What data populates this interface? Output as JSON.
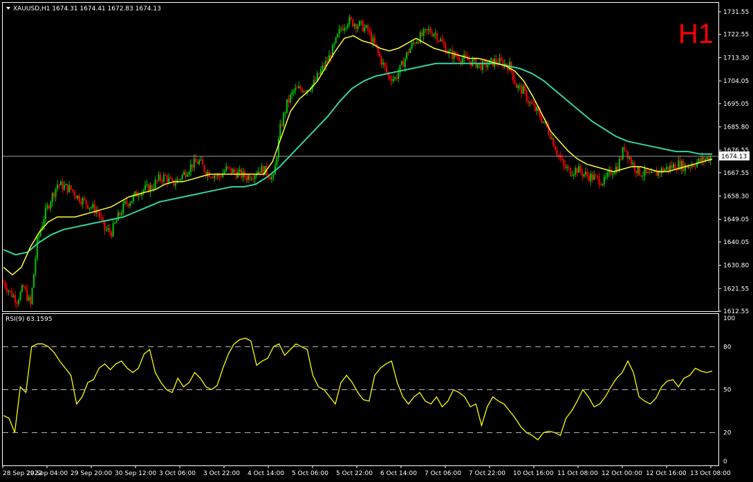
{
  "header": {
    "symbol_line": "XAUUSD,H1  1674.31 1674.41 1672.83 1674.13",
    "timeframe_badge": "H1"
  },
  "price_panel": {
    "current_price_label": "1674.13",
    "y_ticks": [
      "1731.55",
      "1722.55",
      "1713.30",
      "1704.05",
      "1695.05",
      "1685.80",
      "1676.55",
      "1667.55",
      "1658.30",
      "1649.05",
      "1640.05",
      "1630.80",
      "1621.55",
      "1612.55"
    ]
  },
  "rsi_panel": {
    "title": "RSI(9) 63.1595",
    "y_ticks": [
      "100",
      "80",
      "50",
      "20",
      "0"
    ],
    "levels": [
      80,
      50,
      20
    ]
  },
  "x_axis": {
    "labels": [
      "28 Sep 2022",
      "29 Sep 04:00",
      "29 Sep 20:00",
      "30 Sep 12:00",
      "3 Oct 06:00",
      "3 Oct 22:00",
      "4 Oct 14:00",
      "5 Oct 06:00",
      "5 Oct 22:00",
      "6 Oct 14:00",
      "7 Oct 06:00",
      "7 Oct 22:00",
      "10 Oct 16:00",
      "11 Oct 08:00",
      "12 Oct 00:00",
      "12 Oct 16:00",
      "13 Oct 08:00"
    ]
  },
  "colors": {
    "background": "#000000",
    "bull_candle": "#00c800",
    "bear_candle": "#ff0000",
    "ma_fast": "#ffff33",
    "ma_slow": "#33d6a0",
    "rsi_line": "#ffff00",
    "axis": "#ffffff",
    "timeframe": "#ff0000"
  },
  "chart_data": {
    "type": "candlestick",
    "symbol": "XAUUSD",
    "timeframe": "H1",
    "last_bar": {
      "open": 1674.31,
      "high": 1674.41,
      "low": 1672.83,
      "close": 1674.13
    },
    "y_range": [
      1612.55,
      1731.55
    ],
    "price_path_close": [
      1624,
      1620,
      1617,
      1622,
      1615,
      1640,
      1650,
      1657,
      1663,
      1662,
      1661,
      1658,
      1656,
      1654,
      1652,
      1645,
      1644,
      1650,
      1655,
      1657,
      1660,
      1661,
      1662,
      1665,
      1666,
      1663,
      1665,
      1668,
      1671,
      1672,
      1668,
      1667,
      1666,
      1669,
      1668,
      1667,
      1666,
      1667,
      1669,
      1668,
      1665,
      1685,
      1695,
      1700,
      1701,
      1701,
      1703,
      1708,
      1712,
      1718,
      1725,
      1728,
      1727,
      1726,
      1724,
      1718,
      1712,
      1706,
      1705,
      1710,
      1716,
      1720,
      1722,
      1724,
      1723,
      1719,
      1715,
      1714,
      1713,
      1712,
      1711,
      1710,
      1711,
      1712,
      1711,
      1710,
      1702,
      1700,
      1695,
      1692,
      1688,
      1683,
      1676,
      1670,
      1668,
      1669,
      1667,
      1666,
      1665,
      1664,
      1668,
      1670,
      1678,
      1672,
      1668,
      1667,
      1666,
      1668,
      1669,
      1670,
      1671,
      1670,
      1671,
      1672,
      1673,
      1674.13
    ],
    "ma_fast_path": [
      1630,
      1627,
      1630,
      1638,
      1644,
      1648,
      1650,
      1650,
      1650,
      1651,
      1652,
      1653,
      1654,
      1656,
      1658,
      1659,
      1660,
      1661,
      1663,
      1664,
      1664,
      1665,
      1666,
      1667,
      1667,
      1667,
      1667,
      1667,
      1667,
      1667,
      1672,
      1682,
      1692,
      1697,
      1700,
      1704,
      1710,
      1716,
      1721,
      1722,
      1720,
      1719,
      1717,
      1716,
      1717,
      1719,
      1721,
      1719,
      1717,
      1716,
      1715,
      1714,
      1713,
      1713,
      1712,
      1711,
      1710,
      1708,
      1704,
      1698,
      1691,
      1684,
      1680,
      1676,
      1673,
      1671,
      1670,
      1669,
      1668,
      1669,
      1670,
      1670,
      1669,
      1668,
      1668,
      1669,
      1670,
      1671,
      1672,
      1673
    ],
    "ma_slow_path": [
      1637,
      1635,
      1636,
      1640,
      1643,
      1645,
      1646,
      1647,
      1648,
      1649,
      1650,
      1652,
      1654,
      1656,
      1657,
      1658,
      1659,
      1660,
      1661,
      1662,
      1662,
      1663,
      1666,
      1670,
      1675,
      1680,
      1685,
      1690,
      1696,
      1701,
      1704,
      1706,
      1707,
      1708,
      1709,
      1710,
      1711,
      1711,
      1711,
      1711,
      1711,
      1711,
      1710,
      1709,
      1707,
      1704,
      1700,
      1696,
      1692,
      1688,
      1685,
      1682,
      1680,
      1679,
      1678,
      1677,
      1676,
      1676,
      1675,
      1675
    ],
    "rsi_values": [
      32,
      30,
      20,
      52,
      48,
      80,
      82,
      82,
      80,
      76,
      70,
      65,
      60,
      40,
      45,
      55,
      57,
      65,
      68,
      64,
      68,
      70,
      65,
      62,
      65,
      75,
      78,
      62,
      55,
      50,
      48,
      58,
      52,
      55,
      62,
      58,
      52,
      50,
      53,
      65,
      75,
      82,
      85,
      86,
      84,
      67,
      70,
      72,
      80,
      82,
      74,
      78,
      82,
      80,
      78,
      60,
      52,
      50,
      45,
      40,
      55,
      60,
      55,
      48,
      43,
      42,
      60,
      65,
      68,
      70,
      55,
      45,
      40,
      45,
      48,
      42,
      40,
      45,
      38,
      42,
      50,
      48,
      45,
      38,
      40,
      25,
      38,
      45,
      42,
      40,
      35,
      30,
      24,
      20,
      18,
      15,
      20,
      21,
      20,
      18,
      30,
      35,
      42,
      50,
      45,
      38,
      40,
      45,
      52,
      58,
      62,
      70,
      62,
      45,
      42,
      40,
      44,
      52,
      56,
      57,
      52,
      58,
      60,
      65,
      63,
      62,
      63
    ],
    "rsi_levels": [
      80,
      50,
      20
    ],
    "rsi_range": [
      0,
      100
    ],
    "x_labels": [
      "28 Sep 2022",
      "29 Sep 04:00",
      "29 Sep 20:00",
      "30 Sep 12:00",
      "3 Oct 06:00",
      "3 Oct 22:00",
      "4 Oct 14:00",
      "5 Oct 06:00",
      "5 Oct 22:00",
      "6 Oct 14:00",
      "7 Oct 06:00",
      "7 Oct 22:00",
      "10 Oct 16:00",
      "11 Oct 08:00",
      "12 Oct 00:00",
      "12 Oct 16:00",
      "13 Oct 08:00"
    ]
  }
}
